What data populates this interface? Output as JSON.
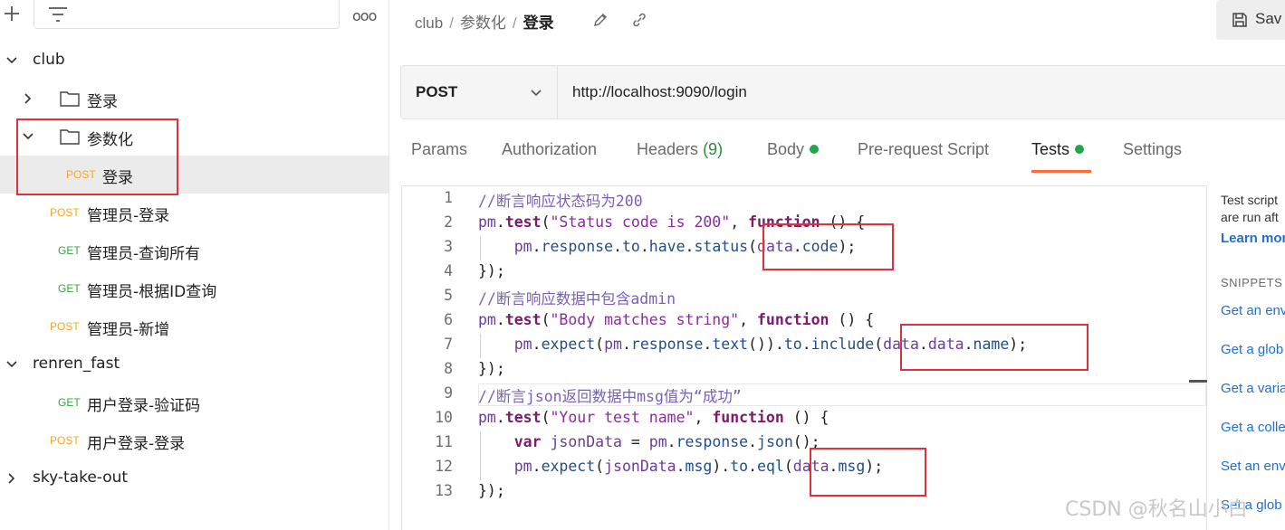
{
  "sidebar": {
    "more_label": "ooo",
    "tree": [
      {
        "label": "club"
      },
      {
        "label": "登录"
      },
      {
        "label": "参数化"
      },
      {
        "method": "POST",
        "label": "登录"
      },
      {
        "method": "POST",
        "label": "管理员-登录"
      },
      {
        "method": "GET",
        "label": "管理员-查询所有"
      },
      {
        "method": "GET",
        "label": "管理员-根据ID查询"
      },
      {
        "method": "POST",
        "label": "管理员-新增"
      },
      {
        "label": "renren_fast"
      },
      {
        "method": "GET",
        "label": "用户登录-验证码"
      },
      {
        "method": "POST",
        "label": "用户登录-登录"
      },
      {
        "label": "sky-take-out"
      }
    ]
  },
  "header": {
    "breadcrumb": [
      "club",
      "参数化",
      "登录"
    ],
    "save_label": "Sav"
  },
  "request": {
    "method": "POST",
    "url": "http://localhost:9090/login"
  },
  "tabs": {
    "params": "Params",
    "authorization": "Authorization",
    "headers": "Headers",
    "headers_count": "(9)",
    "body": "Body",
    "pre_request": "Pre-request Script",
    "tests": "Tests",
    "settings": "Settings"
  },
  "code_lines": [
    "//断言响应状态码为200",
    "pm.test(\"Status code is 200\", function () {",
    "    pm.response.to.have.status(data.code);",
    "});",
    "//断言响应数据中包含admin",
    "pm.test(\"Body matches string\", function () {",
    "    pm.expect(pm.response.text()).to.include(data.data.name);",
    "});",
    "//断言json返回数据中msg值为“成功”",
    "pm.test(\"Your test name\", function () {",
    "    var jsonData = pm.response.json();",
    "    pm.expect(jsonData.msg).to.eql(data.msg);",
    "});"
  ],
  "right_panel": {
    "desc_line1": "Test script",
    "desc_line2": "are run aft",
    "learn_more": "Learn mor",
    "snippets_heading": "SNIPPETS",
    "snippets": [
      "Get an env",
      "Get a glob",
      "Get a varia",
      "Get a colle",
      "Set an env",
      "Set a glob"
    ]
  },
  "watermark": "CSDN @秋名山小白",
  "colors": {
    "accent": "#ff6c37",
    "post": "#f5a623",
    "get": "#3aa14a",
    "highlight_box": "#e0303a",
    "status_dot": "#1fa84a"
  }
}
